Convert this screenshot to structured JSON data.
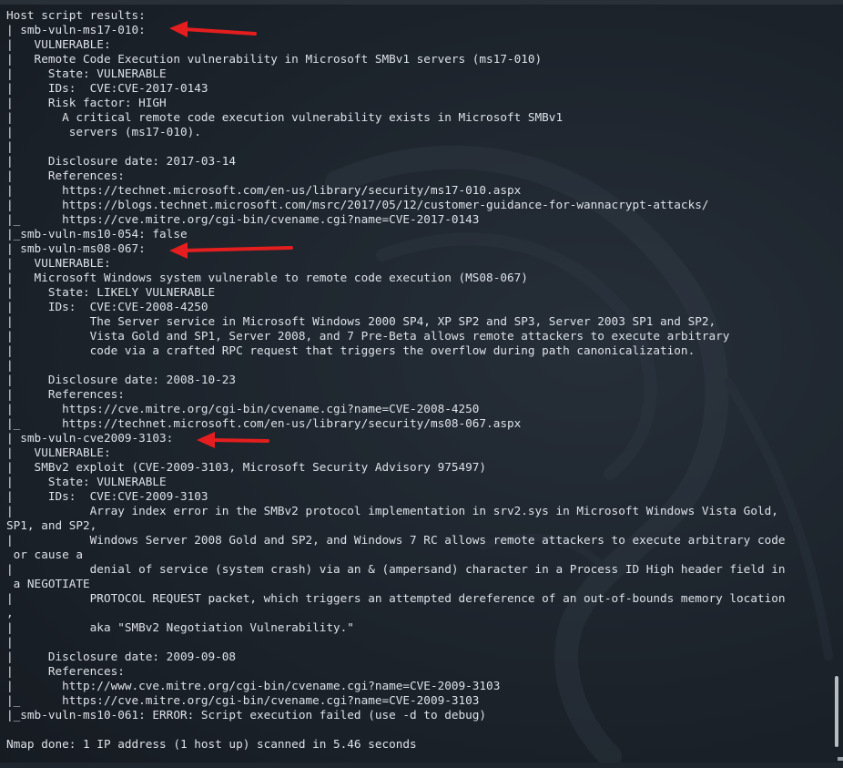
{
  "terminal": {
    "lines": [
      "Host script results:",
      "| smb-vuln-ms17-010:",
      "|   VULNERABLE:",
      "|   Remote Code Execution vulnerability in Microsoft SMBv1 servers (ms17-010)",
      "|     State: VULNERABLE",
      "|     IDs:  CVE:CVE-2017-0143",
      "|     Risk factor: HIGH",
      "|       A critical remote code execution vulnerability exists in Microsoft SMBv1",
      "|        servers (ms17-010).",
      "|",
      "|     Disclosure date: 2017-03-14",
      "|     References:",
      "|       https://technet.microsoft.com/en-us/library/security/ms17-010.aspx",
      "|       https://blogs.technet.microsoft.com/msrc/2017/05/12/customer-guidance-for-wannacrypt-attacks/",
      "|_      https://cve.mitre.org/cgi-bin/cvename.cgi?name=CVE-2017-0143",
      "|_smb-vuln-ms10-054: false",
      "| smb-vuln-ms08-067:",
      "|   VULNERABLE:",
      "|   Microsoft Windows system vulnerable to remote code execution (MS08-067)",
      "|     State: LIKELY VULNERABLE",
      "|     IDs:  CVE:CVE-2008-4250",
      "|           The Server service in Microsoft Windows 2000 SP4, XP SP2 and SP3, Server 2003 SP1 and SP2,",
      "|           Vista Gold and SP1, Server 2008, and 7 Pre-Beta allows remote attackers to execute arbitrary",
      "|           code via a crafted RPC request that triggers the overflow during path canonicalization.",
      "|",
      "|     Disclosure date: 2008-10-23",
      "|     References:",
      "|       https://cve.mitre.org/cgi-bin/cvename.cgi?name=CVE-2008-4250",
      "|_      https://technet.microsoft.com/en-us/library/security/ms08-067.aspx",
      "| smb-vuln-cve2009-3103:",
      "|   VULNERABLE:",
      "|   SMBv2 exploit (CVE-2009-3103, Microsoft Security Advisory 975497)",
      "|     State: VULNERABLE",
      "|     IDs:  CVE:CVE-2009-3103",
      "|           Array index error in the SMBv2 protocol implementation in srv2.sys in Microsoft Windows Vista Gold,",
      "SP1, and SP2,",
      "|           Windows Server 2008 Gold and SP2, and Windows 7 RC allows remote attackers to execute arbitrary code",
      " or cause a",
      "|           denial of service (system crash) via an & (ampersand) character in a Process ID High header field in",
      " a NEGOTIATE",
      "|           PROTOCOL REQUEST packet, which triggers an attempted dereference of an out-of-bounds memory location",
      ",",
      "|           aka \"SMBv2 Negotiation Vulnerability.\"",
      "|",
      "|     Disclosure date: 2009-09-08",
      "|     References:",
      "|       http://www.cve.mitre.org/cgi-bin/cvename.cgi?name=CVE-2009-3103",
      "|_      https://cve.mitre.org/cgi-bin/cvename.cgi?name=CVE-2009-3103",
      "|_smb-vuln-ms10-061: ERROR: Script execution failed (use -d to debug)",
      "",
      "Nmap done: 1 IP address (1 host up) scanned in 5.46 seconds"
    ]
  },
  "annotations": {
    "arrow_color": "#e41e1e",
    "arrow_targets": [
      "smb-vuln-ms17-010",
      "smb-vuln-ms08-067",
      "smb-vuln-cve2009-3103"
    ]
  },
  "colors": {
    "background": "#1b2129",
    "text": "#dde2e8",
    "scrollbar_thumb": "#b9bdc2"
  },
  "scroll": {
    "position_fraction": 0.95
  }
}
